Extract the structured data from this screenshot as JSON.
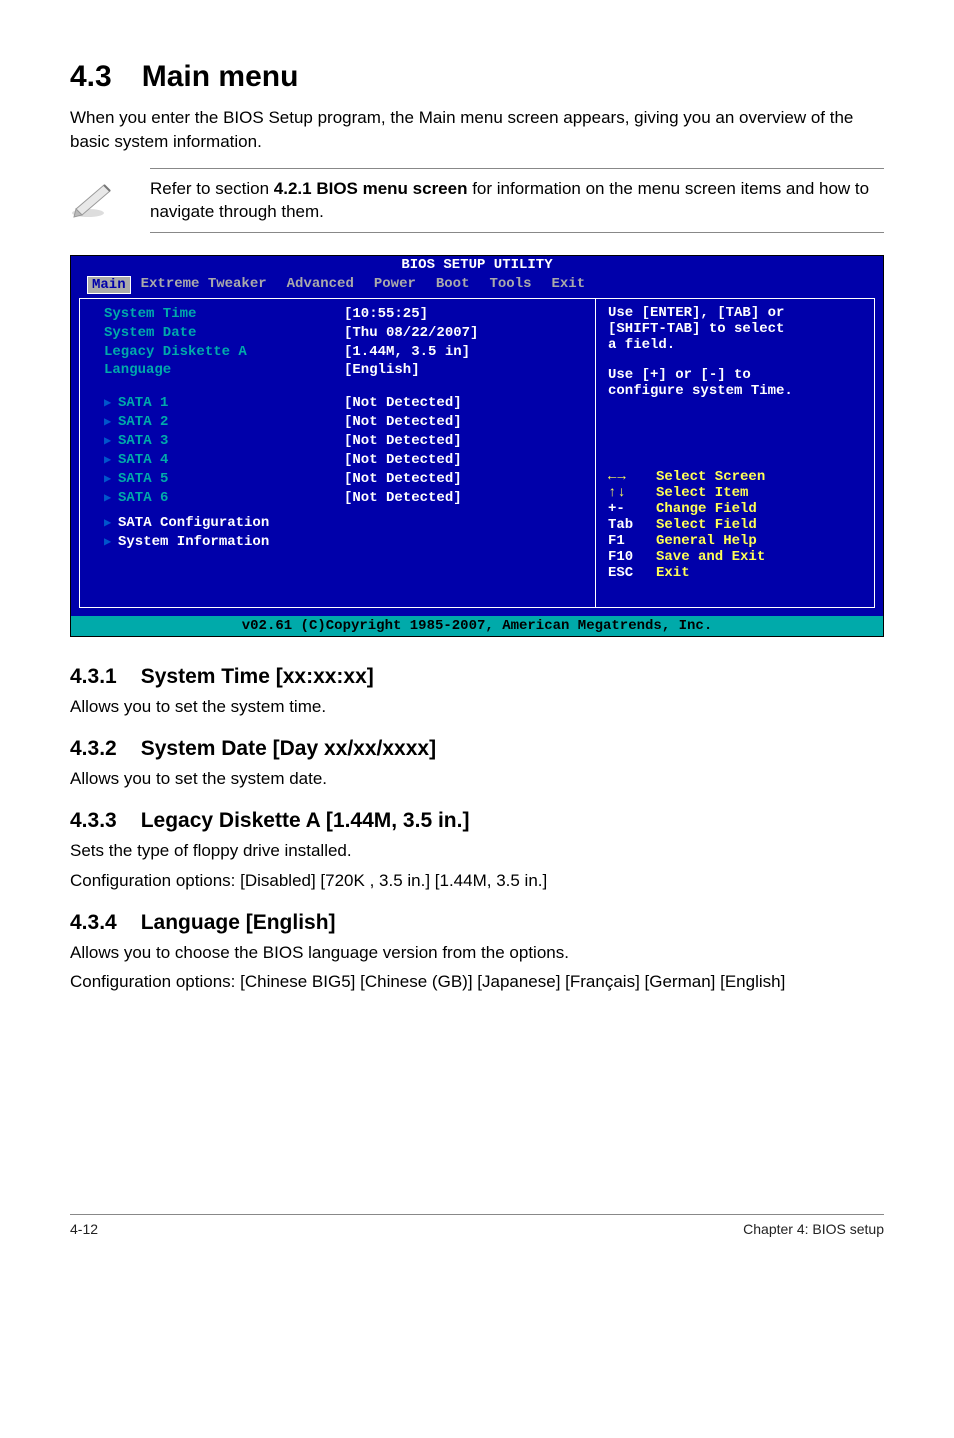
{
  "section": {
    "num": "4.3",
    "title": "Main menu"
  },
  "intro": "When you enter the BIOS Setup program, the Main menu screen appears, giving you an overview of the basic system information.",
  "note": {
    "pre": "Refer to section ",
    "bold": "4.2.1  BIOS menu screen",
    "post": " for information on the menu screen items and how to navigate through them."
  },
  "bios": {
    "title": "BIOS SETUP UTILITY",
    "tabs": [
      "Main",
      "Extreme Tweaker",
      "Advanced",
      "Power",
      "Boot",
      "Tools",
      "Exit"
    ],
    "main_items": [
      {
        "label": "System Time",
        "value": "[10:55:25]"
      },
      {
        "label": "System Date",
        "value": "[Thu 08/22/2007]"
      },
      {
        "label": "Legacy Diskette A",
        "value": "[1.44M, 3.5 in]"
      },
      {
        "label": "Language",
        "value": "[English]"
      }
    ],
    "sata": [
      {
        "label": "SATA 1",
        "value": "[Not Detected]"
      },
      {
        "label": "SATA 2",
        "value": "[Not Detected]"
      },
      {
        "label": "SATA 3",
        "value": "[Not Detected]"
      },
      {
        "label": "SATA 4",
        "value": "[Not Detected]"
      },
      {
        "label": "SATA 5",
        "value": "[Not Detected]"
      },
      {
        "label": "SATA 6",
        "value": "[Not Detected]"
      }
    ],
    "submenu": [
      {
        "label": "SATA Configuration"
      },
      {
        "label": "System Information"
      }
    ],
    "help_top_l1": "Use [ENTER], [TAB] or",
    "help_top_l2": "[SHIFT-TAB] to select",
    "help_top_l3": "a field.",
    "help_top_l4": "Use [+] or [-] to",
    "help_top_l5": "configure system Time.",
    "keys": [
      {
        "k": "←→",
        "d": "Select Screen",
        "arrows": true
      },
      {
        "k": "↑↓",
        "d": "Select Item",
        "arrows": true
      },
      {
        "k": "+-",
        "d": "Change Field"
      },
      {
        "k": "Tab",
        "d": "Select Field"
      },
      {
        "k": "F1",
        "d": "General Help"
      },
      {
        "k": "F10",
        "d": "Save and Exit"
      },
      {
        "k": "ESC",
        "d": "Exit"
      }
    ],
    "footer": "v02.61 (C)Copyright 1985-2007, American Megatrends, Inc."
  },
  "s431": {
    "num": "4.3.1",
    "title": "System Time [xx:xx:xx]",
    "body": "Allows you to set the system time."
  },
  "s432": {
    "num": "4.3.2",
    "title": "System Date [Day xx/xx/xxxx]",
    "body": "Allows you to set the system date."
  },
  "s433": {
    "num": "4.3.3",
    "title": "Legacy Diskette A [1.44M, 3.5 in.]",
    "l1": "Sets the type of floppy drive installed.",
    "l2": "Configuration options: [Disabled] [720K , 3.5 in.] [1.44M, 3.5 in.]"
  },
  "s434": {
    "num": "4.3.4",
    "title": "Language [English]",
    "l1": "Allows you to choose the BIOS language version from the options.",
    "l2": "Configuration options: [Chinese BIG5] [Chinese (GB)] [Japanese] [Français] [German] [English]"
  },
  "footer": {
    "left": "4-12",
    "right": "Chapter 4: BIOS setup"
  }
}
